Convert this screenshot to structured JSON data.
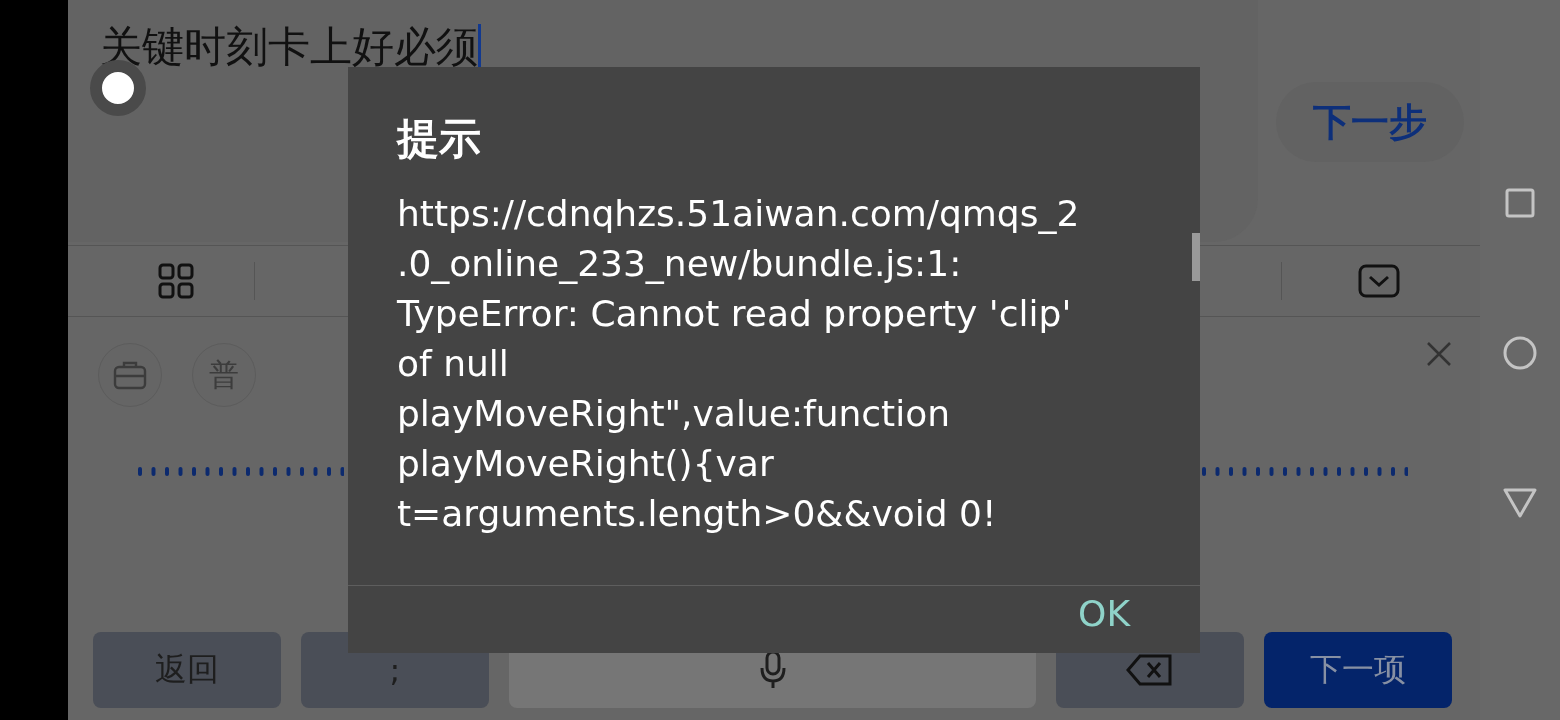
{
  "input": {
    "value": "关键时刻卡上好必须"
  },
  "next_button": {
    "label": "下一步"
  },
  "toolbar": {
    "items": [
      {
        "kind": "grid"
      },
      {
        "kind": "collapse"
      }
    ]
  },
  "mode_buttons": [
    {
      "kind": "briefcase"
    },
    {
      "kind": "text",
      "label": "普"
    }
  ],
  "keys": [
    {
      "kind": "text",
      "label": "返回"
    },
    {
      "kind": "text",
      "label": ";"
    },
    {
      "kind": "mic"
    },
    {
      "kind": "backspace"
    },
    {
      "kind": "primary",
      "label": "下一项"
    }
  ],
  "dialog": {
    "title": "提示",
    "message_lines": [
      "https://cdnqhzs.51aiwan.com/qmqs_2",
      ".0_online_233_new/bundle.js:1:",
      "TypeError: Cannot read property 'clip'",
      "of null",
      "playMoveRight\",value:function",
      "playMoveRight(){var",
      "t=arguments.length>0&&void 0!"
    ],
    "ok_button": "OK"
  }
}
